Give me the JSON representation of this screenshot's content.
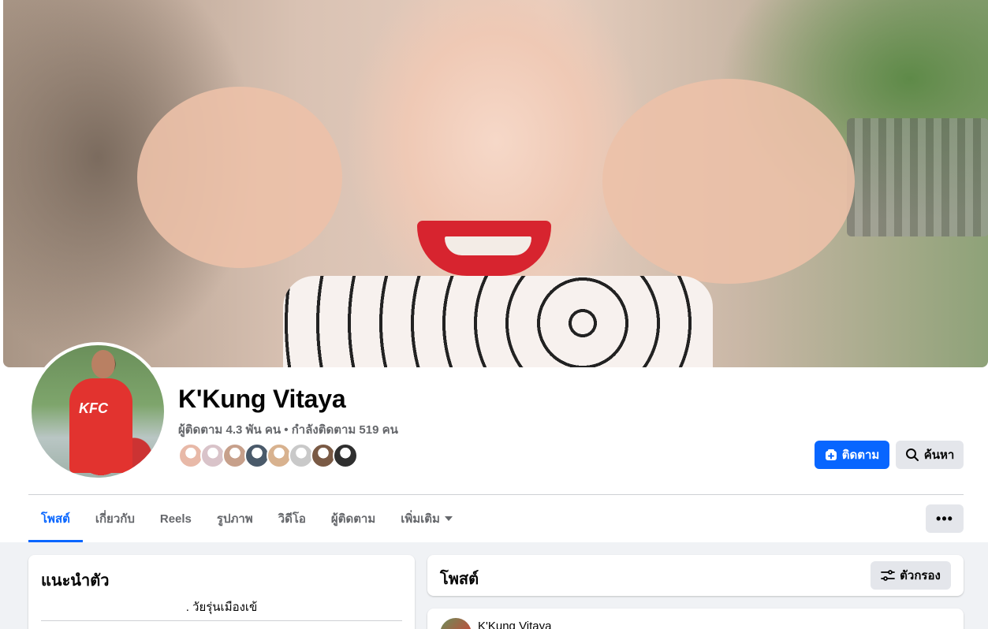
{
  "profile": {
    "name": "K'Kung Vitaya",
    "stats": "ผู้ติดตาม 4.3 พัน คน • กำลังติดตาม 519 คน",
    "friend_avatar_colors": [
      "#e8b9a8",
      "#d9c3c9",
      "#c7a08b",
      "#4a5a6a",
      "#d8b28f",
      "#c9c9c9",
      "#7a5a45",
      "#2f2f2f"
    ]
  },
  "actions": {
    "follow_label": "ติดตาม",
    "search_label": "ค้นหา",
    "more_label": "•••"
  },
  "tabs": [
    {
      "label": "โพสต์"
    },
    {
      "label": "เกี่ยวกับ"
    },
    {
      "label": "Reels"
    },
    {
      "label": "รูปภาพ"
    },
    {
      "label": "วิดีโอ"
    },
    {
      "label": "ผู้ติดตาม"
    },
    {
      "label": "เพิ่มเติม"
    }
  ],
  "intro": {
    "title": "แนะนำตัว",
    "bio": ". วัยรุ่นเมืองเข้"
  },
  "posts": {
    "title": "โพสต์",
    "filter_label": "ตัวกรอง",
    "first_post_author": "K'Kung Vitaya"
  },
  "colors": {
    "accent": "#0866ff",
    "secondary_button": "#e4e6eb",
    "background": "#f0f2f5"
  }
}
